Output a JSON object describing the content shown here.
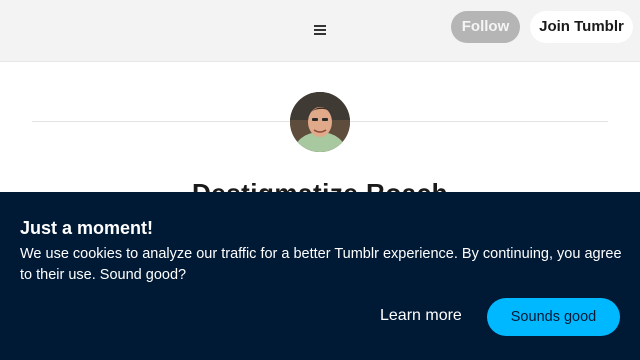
{
  "header": {
    "menu_icon": "hamburger-menu-icon",
    "follow_label": "Follow",
    "join_label": "Join Tumblr"
  },
  "profile": {
    "avatar": "blog-avatar",
    "title": "Destigmatize Roach"
  },
  "cookie_banner": {
    "heading": "Just a moment!",
    "message": "We use cookies to analyze our traffic for a better Tumblr experience. By continuing, you agree to their use. Sound good?",
    "learn_more_label": "Learn more",
    "accept_label": "Sounds good"
  },
  "colors": {
    "banner_background": "#001935",
    "accept_button": "#00b8ff",
    "follow_button": "#b5b5b5"
  }
}
